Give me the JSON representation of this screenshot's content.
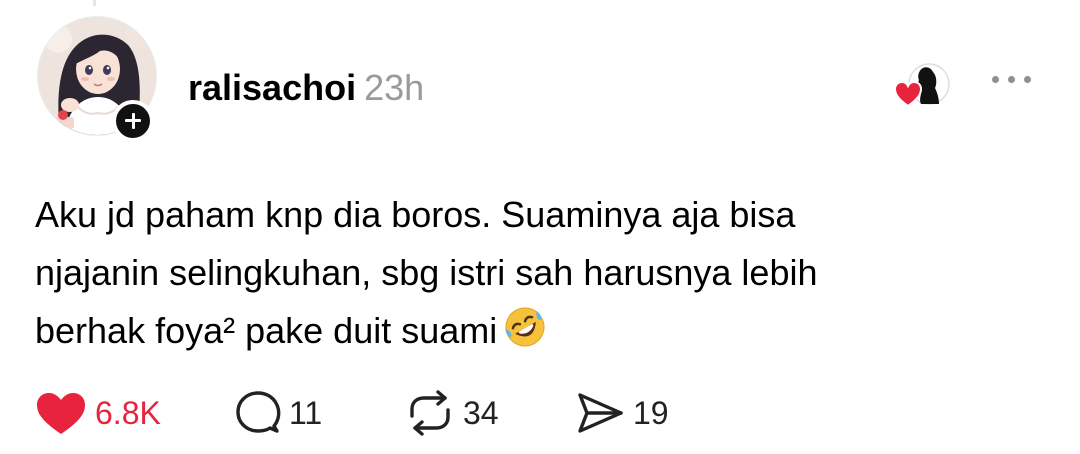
{
  "post": {
    "author": {
      "username": "ralisachoi",
      "avatar": "anime-girl-avatar"
    },
    "timestamp": "23h",
    "text_lines": [
      "Aku jd paham knp dia boros. Suaminya aja bisa",
      "njajanin selingkuhan, sbg istri sah harusnya lebih",
      "berhak foya² pake duit suami"
    ],
    "emoji": "rolling-on-the-floor-laughing-emoji"
  },
  "actions": {
    "likes": "6.8K",
    "replies": "11",
    "reposts": "34",
    "shares": "19"
  },
  "icons": {
    "like": "heart-icon",
    "reply": "comment-bubble-icon",
    "repost": "repost-icon",
    "share": "send-icon",
    "more": "more-dots-icon",
    "follow": "plus-icon",
    "liked_by": "liked-by-avatar-icon"
  },
  "colors": {
    "like_red": "#e8233e",
    "muted_gray": "#9a9a9a",
    "text_black": "#000000"
  }
}
